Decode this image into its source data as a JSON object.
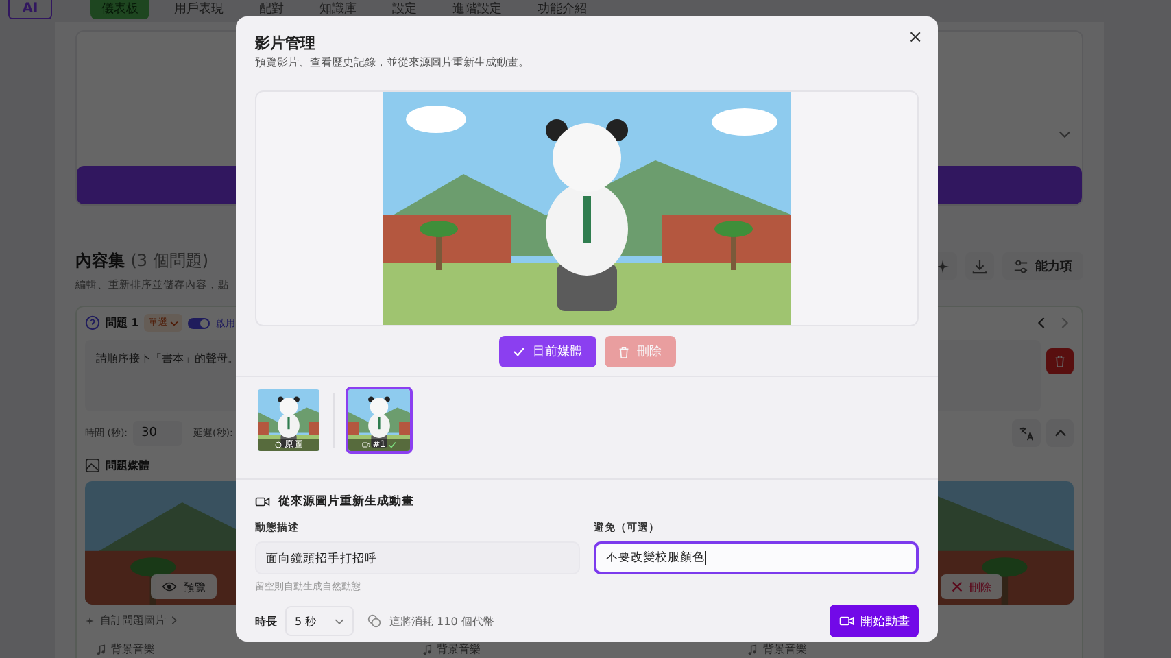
{
  "logo": {
    "text": "AI"
  },
  "nav": {
    "items": [
      {
        "label": "儀表板",
        "selected": true
      },
      {
        "label": "用戶表現",
        "selected": false
      },
      {
        "label": "配對",
        "selected": false
      },
      {
        "label": "知識庫",
        "selected": false
      },
      {
        "label": "設定",
        "selected": false
      },
      {
        "label": "進階設定",
        "selected": false
      },
      {
        "label": "功能介紹",
        "selected": false
      }
    ]
  },
  "content_set": {
    "title": "內容集",
    "count": "(3 個問題)",
    "subtitle": "編輯、重新排序並儲存內容，點",
    "abilities": "能力項"
  },
  "question": {
    "title": "問題 1",
    "type": "單選",
    "enabled": true,
    "enabled_label": "啟用",
    "text": "請順序接下「書本」的聲母。",
    "time_label": "時間 (秒):",
    "time": "30",
    "delay_label": "延遲(秒):",
    "media_title": "問題媒體",
    "preview": "預覽",
    "delete": "刪除",
    "custom_image": "自訂問題圖片",
    "music": [
      "背景音樂",
      "背景音樂",
      "背景音樂"
    ]
  },
  "modal": {
    "title": "影片管理",
    "subtitle": "預覽影片、查看歷史記錄，並從來源圖片重新生成動畫。",
    "close": "×",
    "actions": [
      {
        "label": "目前媒體",
        "kind": "current",
        "disabled": false
      },
      {
        "label": "刪除",
        "kind": "delete",
        "disabled": true
      }
    ],
    "thumbnails": [
      {
        "label": "原圖",
        "kind": "source",
        "selected": false
      },
      {
        "label": "#1",
        "kind": "video",
        "selected": true
      }
    ],
    "regen": {
      "title": "從來源圖片重新生成動畫",
      "motion_label": "動態描述",
      "motion_value": "面向鏡頭招手打招呼",
      "avoid_label": "避免（可選）",
      "avoid_value": "不要改變校服顏色",
      "avoid_focused": true,
      "hint": "留空則自動生成自然動態",
      "duration_label": "時長",
      "duration": "5 秒",
      "cost": "這將消耗 110 個代幣",
      "start": "開始動畫"
    }
  }
}
